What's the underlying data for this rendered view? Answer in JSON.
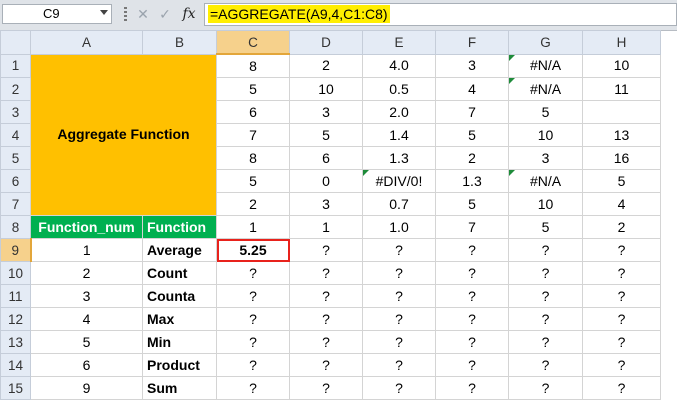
{
  "formula_bar": {
    "name_box": "C9",
    "fx_symbol": "fx",
    "formula": "=AGGREGATE(A9,4,C1:C8)"
  },
  "columns": [
    "A",
    "B",
    "C",
    "D",
    "E",
    "F",
    "G",
    "H"
  ],
  "rows": [
    "1",
    "2",
    "3",
    "4",
    "5",
    "6",
    "7",
    "8",
    "9",
    "10",
    "11",
    "12",
    "13",
    "14",
    "15"
  ],
  "merged_title": "Aggregate Function",
  "data_rows": [
    [
      "8",
      "2",
      "4.0",
      "3",
      "#N/A",
      "10"
    ],
    [
      "5",
      "10",
      "0.5",
      "4",
      "#N/A",
      "11"
    ],
    [
      "6",
      "3",
      "2.0",
      "7",
      "5",
      ""
    ],
    [
      "7",
      "5",
      "1.4",
      "5",
      "10",
      "13"
    ],
    [
      "8",
      "6",
      "1.3",
      "2",
      "3",
      "16"
    ],
    [
      "5",
      "0",
      "#DIV/0!",
      "1.3",
      "#N/A",
      "5"
    ],
    [
      "2",
      "3",
      "0.7",
      "5",
      "10",
      "4"
    ],
    [
      "1",
      "1",
      "1.0",
      "7",
      "5",
      "2"
    ]
  ],
  "header_row": {
    "function_num": "Function_num",
    "function": "Function"
  },
  "function_rows": [
    {
      "num": "1",
      "name": "Average",
      "values": [
        "5.25",
        "?",
        "?",
        "?",
        "?",
        "?"
      ]
    },
    {
      "num": "2",
      "name": "Count",
      "values": [
        "?",
        "?",
        "?",
        "?",
        "?",
        "?"
      ]
    },
    {
      "num": "3",
      "name": "Counta",
      "values": [
        "?",
        "?",
        "?",
        "?",
        "?",
        "?"
      ]
    },
    {
      "num": "4",
      "name": "Max",
      "values": [
        "?",
        "?",
        "?",
        "?",
        "?",
        "?"
      ]
    },
    {
      "num": "5",
      "name": "Min",
      "values": [
        "?",
        "?",
        "?",
        "?",
        "?",
        "?"
      ]
    },
    {
      "num": "6",
      "name": "Product",
      "values": [
        "?",
        "?",
        "?",
        "?",
        "?",
        "?"
      ]
    },
    {
      "num": "9",
      "name": "Sum",
      "values": [
        "?",
        "?",
        "?",
        "?",
        "?",
        "?"
      ]
    }
  ],
  "colors": {
    "orange_fill": "#ffc000",
    "green_fill": "#00b050",
    "selection_border": "#e8221c",
    "formula_highlight": "#ffee00"
  }
}
